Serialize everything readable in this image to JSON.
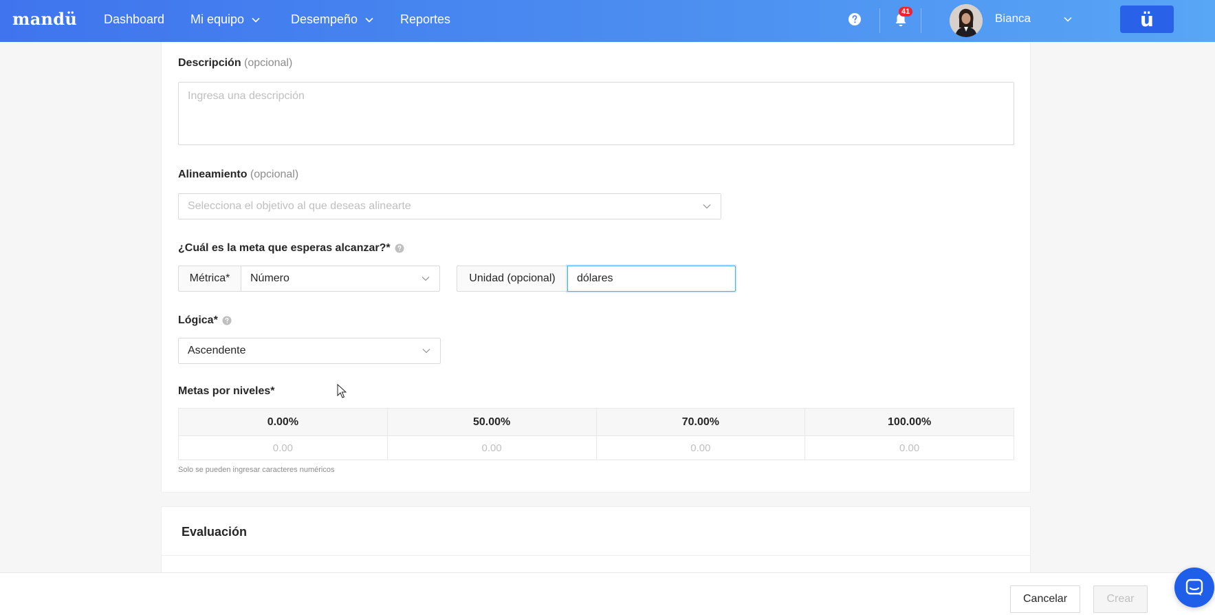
{
  "app": {
    "logo": "mandü",
    "brand_button": "ü"
  },
  "nav": {
    "items": [
      {
        "label": "Dashboard"
      },
      {
        "label": "Mi equipo"
      },
      {
        "label": "Desempeño"
      },
      {
        "label": "Reportes"
      }
    ]
  },
  "topbar": {
    "notifications_count": "41",
    "user_name": "Bianca"
  },
  "form": {
    "description": {
      "label": "Descripción",
      "optional": "(opcional)",
      "placeholder": "Ingresa una descripción"
    },
    "alignment": {
      "label": "Alineamiento",
      "optional": "(opcional)",
      "placeholder": "Selecciona el objetivo al que deseas alinearte"
    },
    "goal": {
      "label": "¿Cuál es la meta que esperas alcanzar?*",
      "metric_label": "Métrica*",
      "metric_value": "Número",
      "unit_label": "Unidad (opcional)",
      "unit_value": "dólares"
    },
    "logic": {
      "label": "Lógica*",
      "value": "Ascendente"
    },
    "levels": {
      "label": "Metas por niveles*",
      "headers": [
        "0.00%",
        "50.00%",
        "70.00%",
        "100.00%"
      ],
      "placeholders": [
        "0.00",
        "0.00",
        "0.00",
        "0.00"
      ],
      "hint": "Solo se pueden ingresar caracteres numéricos"
    }
  },
  "evaluation": {
    "title": "Evaluación"
  },
  "footer": {
    "cancel_label": "Cancelar",
    "create_label": "Crear"
  },
  "colors": {
    "nav_gradient_start": "#3f74ee",
    "nav_gradient_end": "#58a6f6",
    "brand": "#2962e8",
    "focus_border": "#40a9ff",
    "badge": "#f5222d"
  },
  "icons": {
    "help": "question-circle-icon",
    "notifications": "bell-icon",
    "dropdown": "chevron-down-icon",
    "chat": "chat-icon"
  }
}
